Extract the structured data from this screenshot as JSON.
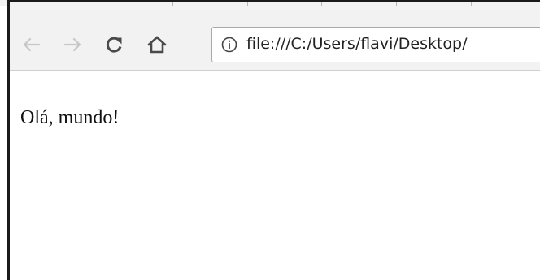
{
  "browser": {
    "toolbar": {
      "back_icon": "arrow-left-icon",
      "back_state": "disabled",
      "forward_icon": "arrow-right-icon",
      "forward_state": "disabled",
      "reload_icon": "reload-icon",
      "home_icon": "home-icon"
    },
    "address_bar": {
      "security_icon": "info-circle-icon",
      "url": "file:///C:/Users/flavi/Desktop/"
    },
    "colors": {
      "chrome_background": "#f2f2f2",
      "disabled_icon": "#c8c8c8",
      "active_icon": "#4a4a4a",
      "window_border": "#1a1a1a"
    }
  },
  "page": {
    "body_text": "Olá, mundo!"
  }
}
